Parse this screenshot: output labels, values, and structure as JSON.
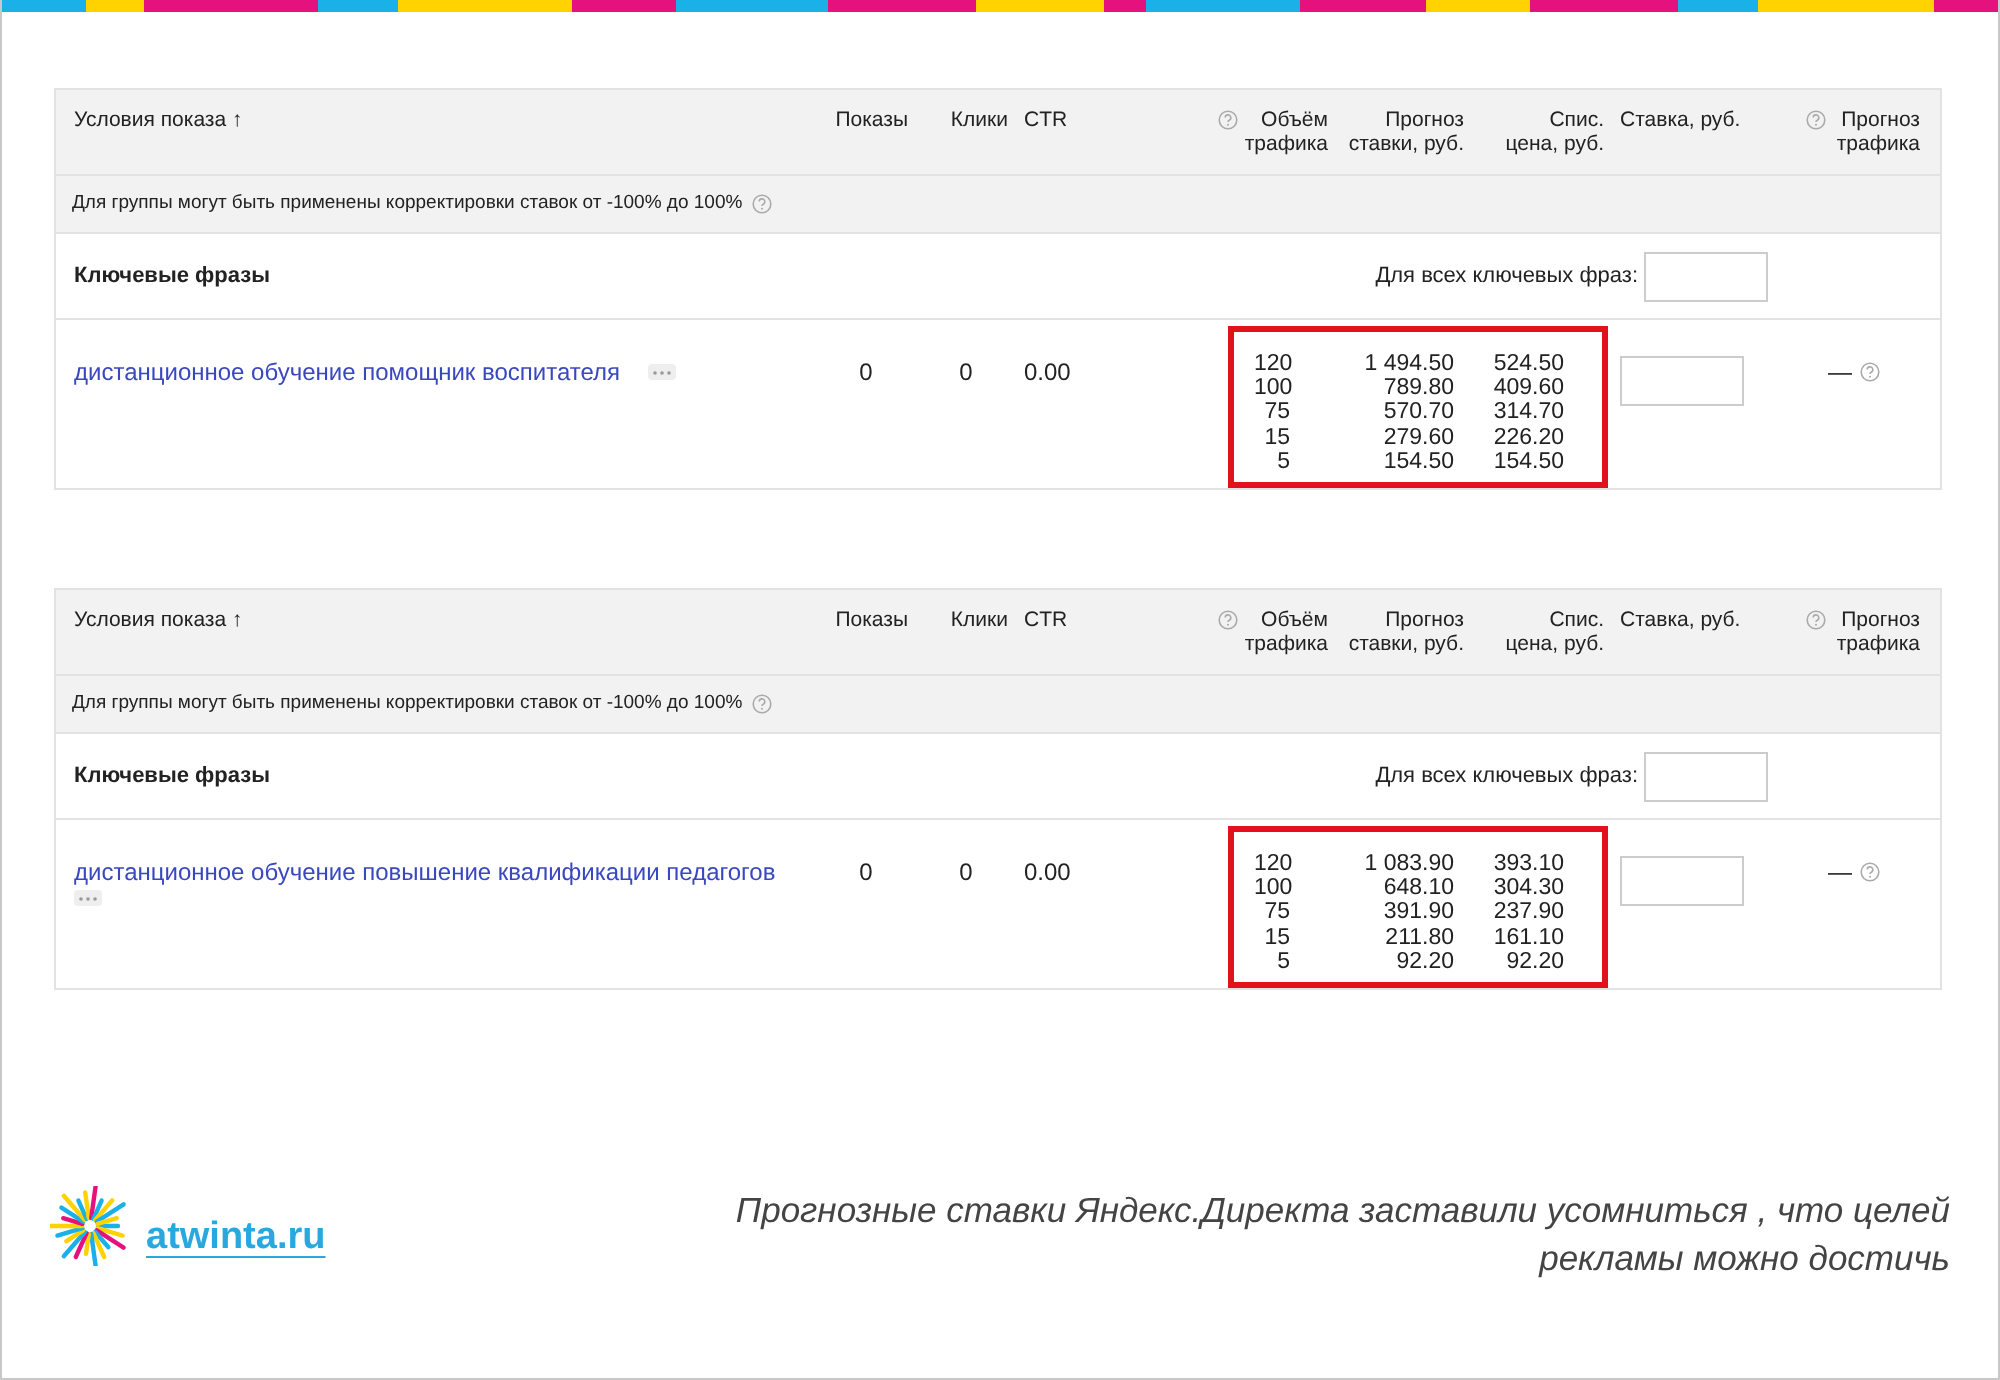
{
  "panels": [
    {
      "columns": [
        {
          "label": "Условия показа ↑",
          "help": false
        },
        {
          "label": "Показы",
          "help": false
        },
        {
          "label": "Клики",
          "help": false
        },
        {
          "label": "CTR",
          "help": false
        },
        {
          "label": "Объём трафика",
          "help": true
        },
        {
          "label": "Прогноз ставки, руб.",
          "help": false
        },
        {
          "label": "Спис. цена, руб.",
          "help": false
        },
        {
          "label": "Ставка, руб.",
          "help": false
        },
        {
          "label": "Прогноз трафика",
          "help": true
        }
      ],
      "note": "Для группы могут быть применены корректировки ставок от -100% до 100%",
      "section": {
        "title": "Ключевые фразы",
        "all_label": "Для всех ключевых фраз:"
      },
      "keyword": {
        "phrase": "дистанционное обучение помощник воспитателя",
        "shows": "0",
        "clicks": "0",
        "ctr": "0.00",
        "traffic": "—",
        "forecast": [
          {
            "volume": "120",
            "bid": "1 494.50",
            "price": "524.50"
          },
          {
            "volume": "100",
            "bid": "789.80",
            "price": "409.60"
          },
          {
            "volume": "75",
            "bid": "570.70",
            "price": "314.70"
          },
          {
            "volume": "15",
            "bid": "279.60",
            "price": "226.20"
          },
          {
            "volume": "5",
            "bid": "154.50",
            "price": "154.50"
          }
        ]
      }
    },
    {
      "columns": [
        {
          "label": "Условия показа ↑",
          "help": false
        },
        {
          "label": "Показы",
          "help": false
        },
        {
          "label": "Клики",
          "help": false
        },
        {
          "label": "CTR",
          "help": false
        },
        {
          "label": "Объём трафика",
          "help": true
        },
        {
          "label": "Прогноз ставки, руб.",
          "help": false
        },
        {
          "label": "Спис. цена, руб.",
          "help": false
        },
        {
          "label": "Ставка, руб.",
          "help": false
        },
        {
          "label": "Прогноз трафика",
          "help": true
        }
      ],
      "note": "Для группы могут быть применены корректировки ставок от -100% до 100%",
      "section": {
        "title": "Ключевые фразы",
        "all_label": "Для всех ключевых фраз:"
      },
      "keyword": {
        "phrase": "дистанционное обучение повышение квалификации педагогов",
        "shows": "0",
        "clicks": "0",
        "ctr": "0.00",
        "traffic": "—",
        "forecast": [
          {
            "volume": "120",
            "bid": "1 083.90",
            "price": "393.10"
          },
          {
            "volume": "100",
            "bid": "648.10",
            "price": "304.30"
          },
          {
            "volume": "75",
            "bid": "391.90",
            "price": "237.90"
          },
          {
            "volume": "15",
            "bid": "211.80",
            "price": "161.10"
          },
          {
            "volume": "5",
            "bid": "92.20",
            "price": "92.20"
          }
        ]
      }
    }
  ],
  "footer": {
    "site": "atwinta.ru",
    "caption": "Прогнозные ставки Яндекс.Директа заставили усомниться , что целей рекламы можно достичь"
  }
}
